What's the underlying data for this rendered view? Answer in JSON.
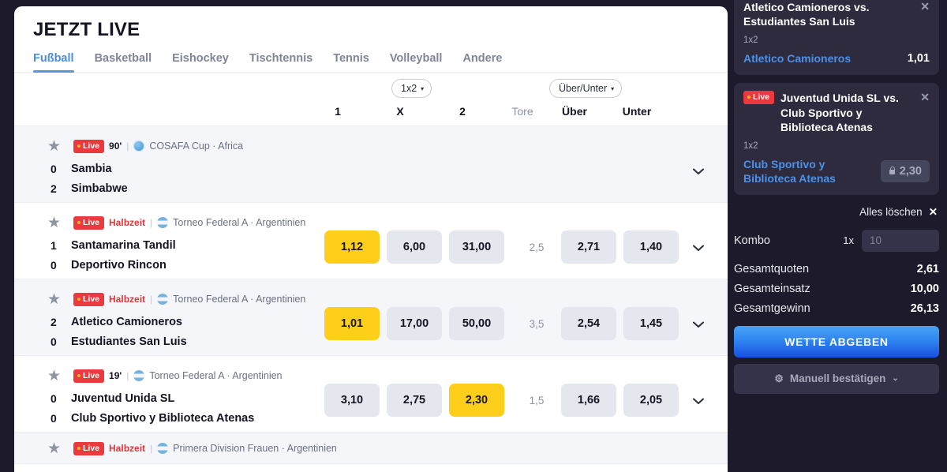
{
  "header": {
    "title": "JETZT LIVE",
    "tabs": [
      {
        "label": "Fußball",
        "active": true
      },
      {
        "label": "Basketball",
        "active": false
      },
      {
        "label": "Eishockey",
        "active": false
      },
      {
        "label": "Tischtennis",
        "active": false
      },
      {
        "label": "Tennis",
        "active": false
      },
      {
        "label": "Volleyball",
        "active": false
      },
      {
        "label": "Andere",
        "active": false
      }
    ]
  },
  "markets": {
    "selector_1x2": "1x2",
    "selector_overunder": "Über/Unter",
    "caret": "▾",
    "columns": [
      {
        "label": "1",
        "muted": false
      },
      {
        "label": "X",
        "muted": false
      },
      {
        "label": "2",
        "muted": false
      },
      {
        "label": "Tore",
        "muted": true
      },
      {
        "label": "Über",
        "muted": false
      },
      {
        "label": "Unter",
        "muted": false
      }
    ]
  },
  "matches": [
    {
      "live_label": "Live",
      "minute": "90'",
      "minute_is_halftime": false,
      "flag": "globe-icon",
      "league": "COSAFA Cup · Africa",
      "home_score": "0",
      "home_team": "Sambia",
      "away_score": "2",
      "away_team": "Simbabwe",
      "odds": {
        "one": "",
        "x": "",
        "two": "",
        "tore": "",
        "ueber": "",
        "unter": ""
      },
      "selected": "",
      "has_odds": false
    },
    {
      "live_label": "Live",
      "minute": "Halbzeit",
      "minute_is_halftime": true,
      "flag": "argentina-flag-icon",
      "league": "Torneo Federal A · Argentinien",
      "home_score": "1",
      "home_team": "Santamarina Tandil",
      "away_score": "0",
      "away_team": "Deportivo Rincon",
      "odds": {
        "one": "1,12",
        "x": "6,00",
        "two": "31,00",
        "tore": "2,5",
        "ueber": "2,71",
        "unter": "1,40"
      },
      "selected": "one",
      "has_odds": true
    },
    {
      "live_label": "Live",
      "minute": "Halbzeit",
      "minute_is_halftime": true,
      "flag": "argentina-flag-icon",
      "league": "Torneo Federal A · Argentinien",
      "home_score": "2",
      "home_team": "Atletico Camioneros",
      "away_score": "0",
      "away_team": "Estudiantes San Luis",
      "odds": {
        "one": "1,01",
        "x": "17,00",
        "two": "50,00",
        "tore": "3,5",
        "ueber": "2,54",
        "unter": "1,45"
      },
      "selected": "one",
      "has_odds": true
    },
    {
      "live_label": "Live",
      "minute": "19'",
      "minute_is_halftime": false,
      "flag": "argentina-flag-icon",
      "league": "Torneo Federal A · Argentinien",
      "home_score": "0",
      "home_team": "Juventud Unida SL",
      "away_score": "0",
      "away_team": "Club Sportivo y Biblioteca Atenas",
      "odds": {
        "one": "3,10",
        "x": "2,75",
        "two": "2,30",
        "tore": "1,5",
        "ueber": "1,66",
        "unter": "2,05"
      },
      "selected": "two",
      "has_odds": true
    },
    {
      "live_label": "Live",
      "minute": "Halbzeit",
      "minute_is_halftime": true,
      "flag": "argentina-flag-icon",
      "league": "Primera Division Frauen · Argentinien",
      "home_score": "",
      "home_team": "",
      "away_score": "",
      "away_team": "",
      "odds": {
        "one": "",
        "x": "",
        "two": "",
        "tore": "",
        "ueber": "",
        "unter": ""
      },
      "selected": "",
      "has_odds": false
    }
  ],
  "betslip": {
    "items": [
      {
        "live_label": "Live",
        "title": "Atletico Camioneros vs. Estudiantes San Luis",
        "market": "1x2",
        "pick": "Atletico Camioneros",
        "odd": "1,01",
        "locked": false,
        "close": "✕"
      },
      {
        "live_label": "Live",
        "title": "Juventud Unida SL vs. Club Sportivo y Biblioteca Atenas",
        "market": "1x2",
        "pick": "Club Sportivo y Biblioteca Atenas",
        "odd": "2,30",
        "locked": true,
        "close": "✕"
      }
    ],
    "clear_all_label": "Alles löschen",
    "clear_all_x": "✕",
    "kombo_label": "Kombo",
    "kombo_multiplier": "1x",
    "stake_placeholder": "10",
    "stake_value": "",
    "summary": [
      {
        "label": "Gesamtquoten",
        "value": "2,61"
      },
      {
        "label": "Gesamteinsatz",
        "value": "10,00"
      },
      {
        "label": "Gesamtgewinn",
        "value": "26,13"
      }
    ],
    "submit_label": "WETTE ABGEBEN",
    "confirm_label": "Manuell bestätigen",
    "gear": "⚙",
    "confirm_caret": "⌄"
  },
  "colors": {
    "accent_blue": "#4b8ddb",
    "selected_odd": "#fdcf1b",
    "live_red": "#ea3a3d",
    "slip_bg": "#2d2b3d",
    "page_bg": "#1d1b2b"
  }
}
